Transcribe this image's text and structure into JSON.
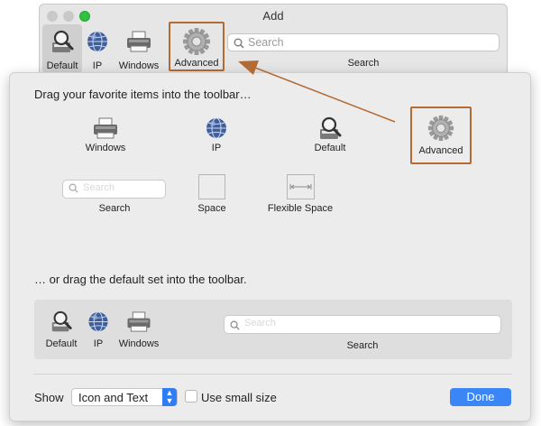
{
  "window": {
    "title": "Add",
    "toolbar_items": [
      {
        "label": "Default",
        "icon": "magnifier-doc-icon"
      },
      {
        "label": "IP",
        "icon": "globe-icon"
      },
      {
        "label": "Windows",
        "icon": "printer-icon"
      },
      {
        "label": "Advanced",
        "icon": "gear-icon"
      }
    ],
    "search": {
      "placeholder": "Search",
      "label": "Search"
    }
  },
  "sheet": {
    "heading1": "Drag your favorite items into the toolbar…",
    "heading2": "… or drag the default set into the toolbar.",
    "palette": [
      {
        "label": "Windows",
        "icon": "printer-icon"
      },
      {
        "label": "IP",
        "icon": "globe-icon"
      },
      {
        "label": "Default",
        "icon": "magnifier-doc-icon"
      },
      {
        "label": "Advanced",
        "icon": "gear-icon"
      },
      {
        "label": "Search",
        "icon": "search-field-icon"
      },
      {
        "label": "Space",
        "icon": "space-icon"
      },
      {
        "label": "Flexible Space",
        "icon": "flexible-space-icon"
      }
    ],
    "palette_search_placeholder": "Search",
    "default_set": {
      "items": [
        {
          "label": "Default"
        },
        {
          "label": "IP"
        },
        {
          "label": "Windows"
        }
      ],
      "search_placeholder": "Search",
      "search_label": "Search"
    },
    "show_label": "Show",
    "show_value": "Icon and Text",
    "small_size_label": "Use small size",
    "done_label": "Done"
  },
  "colors": {
    "highlight": "#b36b35",
    "accent": "#3b86f7"
  }
}
